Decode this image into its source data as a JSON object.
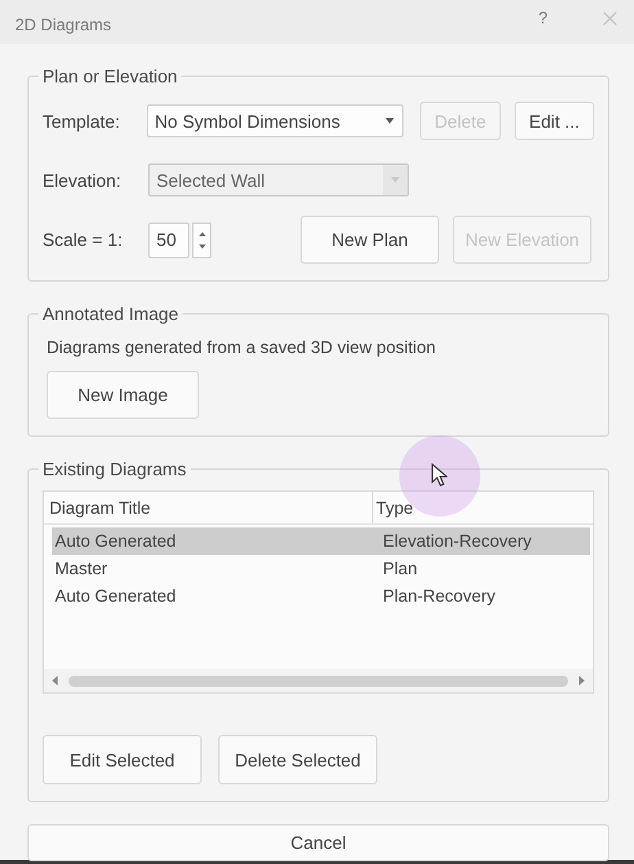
{
  "window": {
    "title": "2D Diagrams",
    "help": "?"
  },
  "plan_or_elevation": {
    "title": "Plan or Elevation",
    "template": {
      "label": "Template:",
      "value": "No Symbol Dimensions",
      "disabled": false
    },
    "delete_button": {
      "label": "Delete",
      "disabled": true
    },
    "edit_button": {
      "label": "Edit ...",
      "disabled": false
    },
    "elevation": {
      "label": "Elevation:",
      "value": "Selected Wall",
      "disabled": true
    },
    "scale": {
      "label": "Scale = 1:",
      "value": "50"
    },
    "new_plan_button": {
      "label": "New Plan",
      "disabled": false
    },
    "new_elevation_button": {
      "label": "New Elevation",
      "disabled": true
    }
  },
  "annotated_image": {
    "title": "Annotated Image",
    "description": "Diagrams generated from a saved 3D view position",
    "new_image_button": {
      "label": "New Image",
      "disabled": false
    }
  },
  "existing_diagrams": {
    "title": "Existing Diagrams",
    "columns": [
      "Diagram Title",
      "Type"
    ],
    "rows": [
      {
        "cells": [
          "Auto Generated",
          "Elevation-Recovery"
        ],
        "selected": true
      },
      {
        "cells": [
          "Master",
          "Plan"
        ],
        "selected": false
      },
      {
        "cells": [
          "Auto Generated",
          "Plan-Recovery"
        ],
        "selected": false
      }
    ],
    "edit_selected_button": {
      "label": "Edit Selected",
      "disabled": false
    },
    "delete_selected_button": {
      "label": "Delete Selected",
      "disabled": false
    }
  },
  "cancel_button": {
    "label": "Cancel",
    "disabled": false
  }
}
